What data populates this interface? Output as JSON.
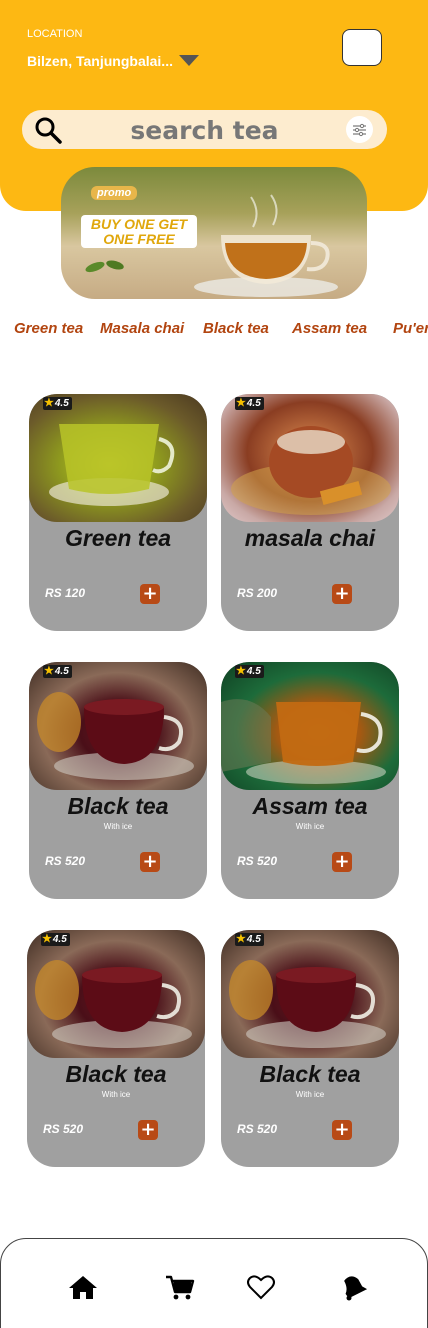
{
  "header": {
    "location_label": "LOCATION",
    "location_value": "Bilzen, Tanjungbalai...",
    "caret_icon": "triangle-down-icon",
    "profile_icon": "profile-box",
    "background_color": "#fdb813"
  },
  "search": {
    "placeholder": "search tea",
    "icon": "search-icon",
    "filter_icon": "sliders-icon"
  },
  "promo": {
    "badge": "promo",
    "text": "BUY ONE GET ONE FREE"
  },
  "categories": [
    "Green tea",
    "Masala chai",
    "Black tea",
    "Assam tea",
    "Pu'er"
  ],
  "products": [
    {
      "name": "Green tea",
      "subtitle": "",
      "price": "RS 120",
      "rating": "4.5"
    },
    {
      "name": "masala chai",
      "subtitle": "",
      "price": "RS 200",
      "rating": "4.5"
    },
    {
      "name": "Black tea",
      "subtitle": "With ice",
      "price": "RS 520",
      "rating": "4.5"
    },
    {
      "name": "Assam tea",
      "subtitle": "With ice",
      "price": "RS 520",
      "rating": "4.5"
    },
    {
      "name": "Black tea",
      "subtitle": "With ice",
      "price": "RS 520",
      "rating": "4.5"
    },
    {
      "name": "Black tea",
      "subtitle": "With ice",
      "price": "RS 520",
      "rating": "4.5"
    }
  ],
  "add_label": "+",
  "nav": [
    "home-icon",
    "cart-icon",
    "heart-icon",
    "bell-icon"
  ],
  "colors": {
    "accent": "#fdb813",
    "category_text": "#b24510",
    "card_bg": "#a0a0a0",
    "add_button": "#b84a16"
  }
}
